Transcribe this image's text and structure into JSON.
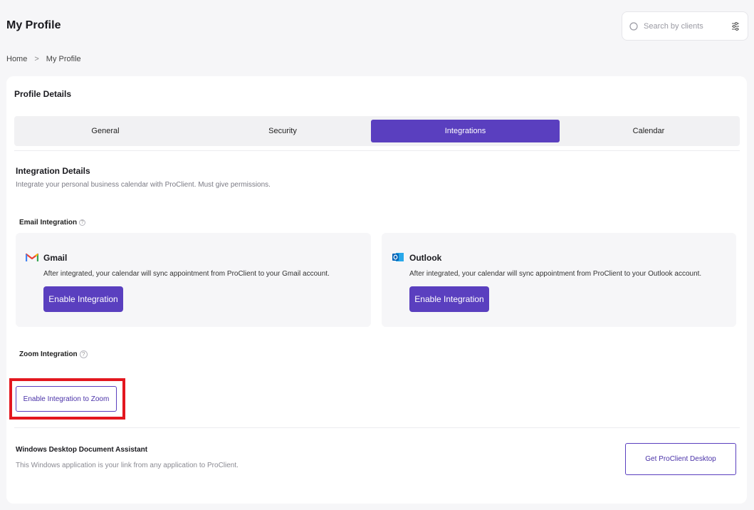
{
  "header": {
    "title": "My Profile",
    "search_placeholder": "Search by clients"
  },
  "breadcrumb": {
    "home": "Home",
    "separator": ">",
    "current": "My Profile"
  },
  "card": {
    "title": "Profile Details",
    "tabs": [
      {
        "label": "General",
        "active": false
      },
      {
        "label": "Security",
        "active": false
      },
      {
        "label": "Integrations",
        "active": true
      },
      {
        "label": "Calendar",
        "active": false
      }
    ]
  },
  "integration": {
    "title": "Integration Details",
    "description": "Integrate your personal business calendar with ProClient. Must give permissions.",
    "email_label": "Email Integration",
    "gmail": {
      "name": "Gmail",
      "description": "After integrated, your calendar will sync appointment from ProClient to your Gmail account.",
      "button": "Enable Integration"
    },
    "outlook": {
      "name": "Outlook",
      "description": "After integrated, your calendar will sync appointment from ProClient to your Outlook account.",
      "button": "Enable Integration"
    },
    "zoom_label": "Zoom Integration",
    "zoom_button": "Enable Integration to Zoom"
  },
  "desktop": {
    "title": "Windows Desktop Document Assistant",
    "description": "This Windows application is your link from any application to ProClient.",
    "button": "Get ProClient Desktop"
  },
  "colors": {
    "accent": "#5a3fbf",
    "highlight": "#e3171f"
  }
}
